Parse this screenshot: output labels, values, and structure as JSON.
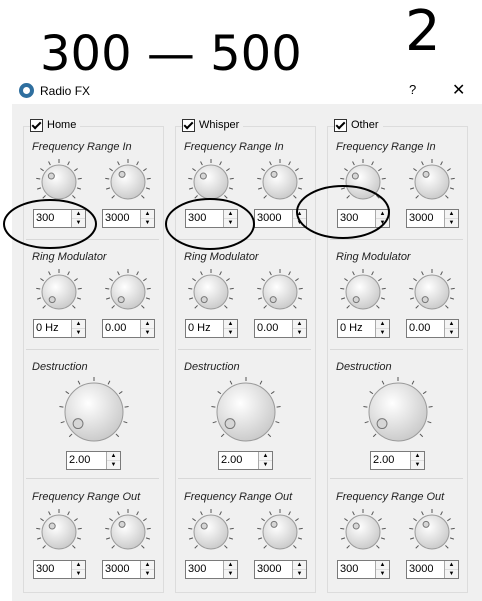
{
  "annotation": {
    "range_text": "300 — 500",
    "digit_text": "2"
  },
  "window": {
    "title": "Radio FX",
    "help": "?",
    "close": "✕"
  },
  "labels": {
    "freq_in": "Frequency Range In",
    "ring": "Ring Modulator",
    "destruction": "Destruction",
    "freq_out": "Frequency Range Out"
  },
  "groups": [
    {
      "name": "Home",
      "freq_in_low": "300",
      "freq_in_high": "3000",
      "ring_freq": "0 Hz",
      "ring_mix": "0.00",
      "destruction": "2.00",
      "freq_out_low": "300",
      "freq_out_high": "3000"
    },
    {
      "name": "Whisper",
      "freq_in_low": "300",
      "freq_in_high": "3000",
      "ring_freq": "0 Hz",
      "ring_mix": "0.00",
      "destruction": "2.00",
      "freq_out_low": "300",
      "freq_out_high": "3000"
    },
    {
      "name": "Other",
      "freq_in_low": "300",
      "freq_in_high": "3000",
      "ring_freq": "0 Hz",
      "ring_mix": "0.00",
      "destruction": "2.00",
      "freq_out_low": "300",
      "freq_out_high": "3000"
    }
  ],
  "spin_arrows": {
    "up": "▲",
    "down": "▼"
  }
}
